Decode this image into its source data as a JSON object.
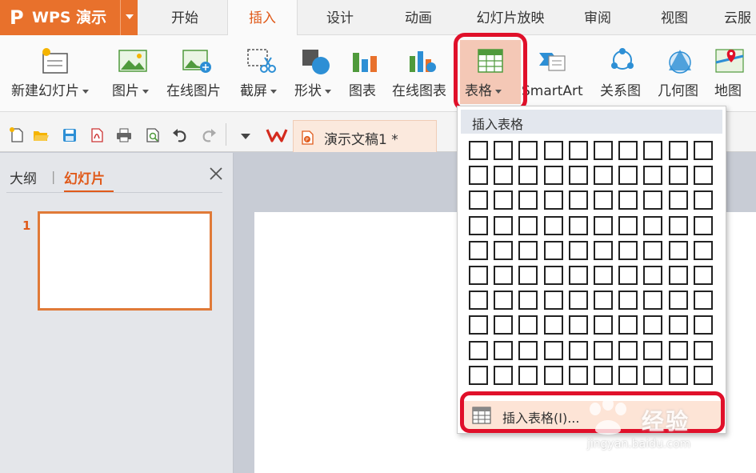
{
  "app": {
    "name": "WPS 演示"
  },
  "tabs": [
    "开始",
    "插入",
    "设计",
    "动画",
    "幻灯片放映",
    "审阅",
    "视图",
    "云服"
  ],
  "active_tab": "插入",
  "ribbon": {
    "new_slide": "新建幻灯片",
    "picture": "图片",
    "online_picture": "在线图片",
    "screenshot": "截屏",
    "shape": "形状",
    "chart": "图表",
    "online_chart": "在线图表",
    "table": "表格",
    "smartart": "SmartArt",
    "relation": "关系图",
    "geometry": "几何图",
    "map": "地图"
  },
  "document": {
    "title": "演示文稿1 *"
  },
  "left_pane": {
    "outline_tab": "大纲",
    "separator": "|",
    "slides_tab": "幻灯片",
    "slide_number": "1"
  },
  "dropdown": {
    "header": "插入表格",
    "grid_rows": 10,
    "grid_cols": 10,
    "insert_item": "插入表格(I)..."
  },
  "watermark": {
    "brand": "经验",
    "url": "jingyan.baidu.com"
  },
  "colors": {
    "accent": "#e8712c",
    "highlight_ring": "#e0102a",
    "active_tab_text": "#e05a1a"
  }
}
